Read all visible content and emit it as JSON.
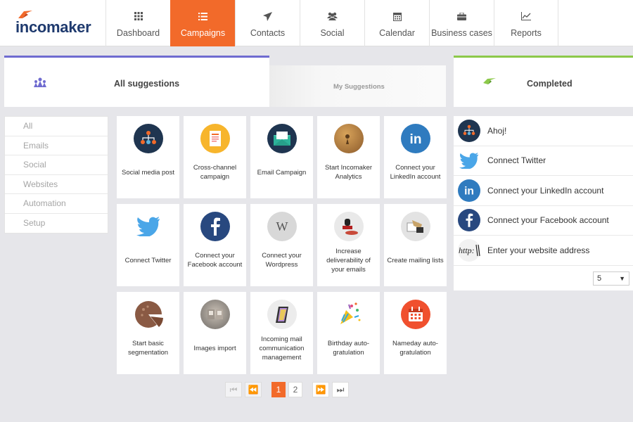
{
  "app": {
    "logo_text": "incomaker"
  },
  "nav": {
    "items": [
      {
        "label": "Dashboard",
        "icon": "grid-icon"
      },
      {
        "label": "Campaigns",
        "icon": "list-icon",
        "active": true
      },
      {
        "label": "Contacts",
        "icon": "send-icon"
      },
      {
        "label": "Social",
        "icon": "users-icon"
      },
      {
        "label": "Calendar",
        "icon": "calendar-icon"
      },
      {
        "label": "Business cases",
        "icon": "briefcase-icon"
      },
      {
        "label": "Reports",
        "icon": "chart-icon"
      }
    ]
  },
  "tabs": {
    "all": "All suggestions",
    "my": "My Suggestions",
    "completed": "Completed"
  },
  "categories": [
    "All",
    "Emails",
    "Social",
    "Websites",
    "Automation",
    "Setup"
  ],
  "cards": [
    {
      "label": "Social media post",
      "icon": "hierarchy-icon"
    },
    {
      "label": "Cross-channel campaign",
      "icon": "document-icon"
    },
    {
      "label": "Email Campaign",
      "icon": "envelope-icon"
    },
    {
      "label": "Start Incomaker Analytics",
      "icon": "analytics-icon"
    },
    {
      "label": "Connect your LinkedIn account",
      "icon": "linkedin-icon"
    },
    {
      "label": "Connect Twitter",
      "icon": "twitter-icon"
    },
    {
      "label": "Connect your Facebook account",
      "icon": "facebook-icon"
    },
    {
      "label": "Connect your Wordpress",
      "icon": "wordpress-icon"
    },
    {
      "label": "Increase deliverability of your emails",
      "icon": "stamp-icon"
    },
    {
      "label": "Create mailing lists",
      "icon": "mailing-icon"
    },
    {
      "label": "Start basic segmentation",
      "icon": "pie-icon"
    },
    {
      "label": "Images import",
      "icon": "images-icon"
    },
    {
      "label": "Incoming mail communication management",
      "icon": "mail-management-icon"
    },
    {
      "label": "Birthday auto-gratulation",
      "icon": "party-icon"
    },
    {
      "label": "Nameday auto-gratulation",
      "icon": "calendar-icon"
    }
  ],
  "pagination": {
    "first": "⏮",
    "prev": "⏪",
    "pages": [
      "1",
      "2"
    ],
    "current": "1",
    "next": "⏩",
    "last": "⏭"
  },
  "completed": {
    "items": [
      {
        "label": "Ahoj!",
        "icon": "hierarchy-icon"
      },
      {
        "label": "Connect Twitter",
        "icon": "twitter-icon"
      },
      {
        "label": "Connect your LinkedIn account",
        "icon": "linkedin-icon"
      },
      {
        "label": "Connect your Facebook account",
        "icon": "facebook-icon"
      },
      {
        "label": "Enter your website address",
        "icon": "http-icon"
      }
    ],
    "page_size": "5"
  },
  "colors": {
    "accent": "#f26a2a",
    "brand": "#1f3a6e",
    "all_tab": "#6f6bd0",
    "completed_tab": "#8cc94a"
  }
}
